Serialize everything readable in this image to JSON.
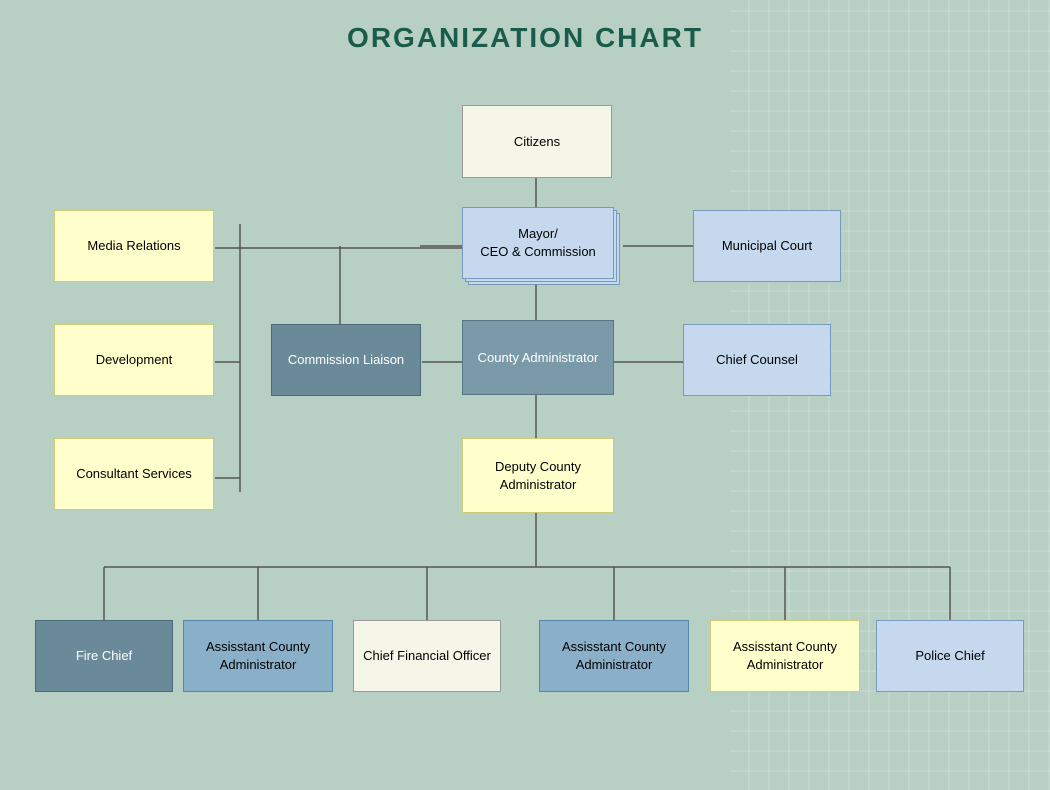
{
  "title": "ORGANIZATION CHART",
  "boxes": {
    "citizens": {
      "label": "Citizens"
    },
    "mayor": {
      "label": "Mayor/\nCEO & Commission"
    },
    "municipal_court": {
      "label": "Municipal Court"
    },
    "media_relations": {
      "label": "Media Relations"
    },
    "development": {
      "label": "Development"
    },
    "consultant_services": {
      "label": "Consultant\nServices"
    },
    "commission_liaison": {
      "label": "Commission\nLiaison"
    },
    "county_admin": {
      "label": "County\nAdministrator"
    },
    "chief_counsel": {
      "label": "Chief Counsel"
    },
    "deputy_county_admin": {
      "label": "Deputy County\nAdministrator"
    },
    "fire_chief": {
      "label": "Fire Chief"
    },
    "asst_county_admin1": {
      "label": "Assisstant County\nAdministrator"
    },
    "cfo": {
      "label": "Chief Financial\nOfficer"
    },
    "asst_county_admin2": {
      "label": "Assisstant County\nAdministrator"
    },
    "asst_county_admin3": {
      "label": "Assisstant County\nAdministrator"
    },
    "police_chief": {
      "label": "Police Chief"
    }
  }
}
